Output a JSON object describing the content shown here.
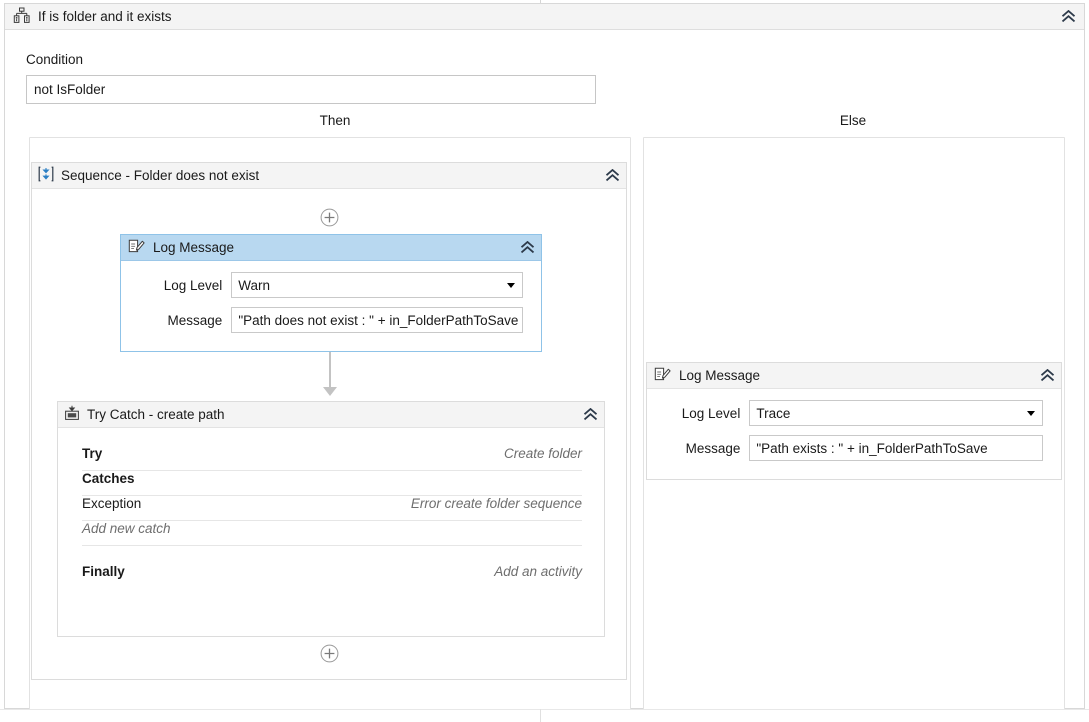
{
  "activity": {
    "title": "If is folder and it exists",
    "icon": "if-branch-icon",
    "collapse_icon": "double-chevron-up-icon"
  },
  "condition": {
    "label": "Condition",
    "value": "not IsFolder"
  },
  "branches": {
    "then_label": "Then",
    "else_label": "Else"
  },
  "sequence": {
    "title": "Sequence - Folder does not exist",
    "icon": "sequence-icon",
    "collapse_icon": "double-chevron-up-icon",
    "add_top_label": "+",
    "add_bottom_label": "+"
  },
  "log_message_then": {
    "title": "Log Message",
    "icon": "log-message-icon",
    "collapse_icon": "double-chevron-up-icon",
    "selected": true,
    "fields": {
      "log_level_label": "Log Level",
      "log_level_value": "Warn",
      "message_label": "Message",
      "message_value": "\"Path does not exist : \" + in_FolderPathToSave"
    }
  },
  "try_catch": {
    "title": "Try Catch - create path",
    "icon": "try-catch-icon",
    "collapse_icon": "double-chevron-up-icon",
    "try_label": "Try",
    "try_value": "Create folder",
    "catches_label": "Catches",
    "exception_label": "Exception",
    "exception_value": "Error create folder sequence",
    "add_new_catch_label": "Add new catch",
    "finally_label": "Finally",
    "finally_value": "Add an activity"
  },
  "log_message_else": {
    "title": "Log Message",
    "icon": "log-message-icon",
    "collapse_icon": "double-chevron-up-icon",
    "selected": false,
    "fields": {
      "log_level_label": "Log Level",
      "log_level_value": "Trace",
      "message_label": "Message",
      "message_value": "\"Path exists : \" + in_FolderPathToSave"
    }
  },
  "colors": {
    "selection_header": "#b8d8f0",
    "selection_border": "#8fc3e8",
    "panel_header": "#f4f4f4",
    "accent_blue": "#2b7fc4",
    "text": "#1a1a1a",
    "muted_text": "#6e6e6e",
    "border": "#dcdcdc",
    "connector": "#c3c3c3"
  }
}
